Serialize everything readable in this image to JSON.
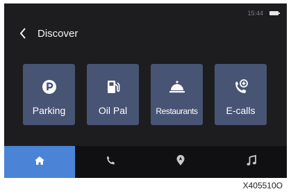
{
  "status": {
    "time": "15:44"
  },
  "header": {
    "title": "Discover"
  },
  "tiles": [
    {
      "label": "Parking",
      "icon": "parking-icon"
    },
    {
      "label": "Oil Pal",
      "icon": "fuel-pump-icon"
    },
    {
      "label": "Restaurants",
      "icon": "cloche-icon"
    },
    {
      "label": "E-calls",
      "icon": "emergency-phone-icon"
    }
  ],
  "bottom_nav": [
    {
      "icon": "home-icon",
      "active": true
    },
    {
      "icon": "phone-icon",
      "active": false
    },
    {
      "icon": "navigation-pin-icon",
      "active": false
    },
    {
      "icon": "music-note-icon",
      "active": false
    }
  ],
  "figure_code": "X405510O",
  "colors": {
    "screen_bg": "#1d1d1f",
    "tile_bg": "#475474",
    "active_tab": "#4b84d6",
    "nav_bg": "#101012"
  }
}
